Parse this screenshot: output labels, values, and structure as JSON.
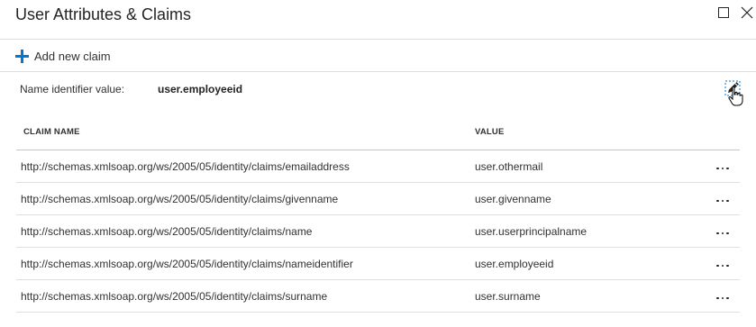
{
  "header": {
    "title": "User Attributes & Claims",
    "maximize_icon": "maximize-icon",
    "close_icon": "close-icon"
  },
  "toolbar": {
    "add_claim_label": "Add new claim",
    "add_icon": "plus-icon",
    "accent_color": "#0078d4"
  },
  "name_identifier": {
    "label": "Name identifier value:",
    "value": "user.employeeid",
    "edit_icon": "edit-icon"
  },
  "table": {
    "columns": {
      "claim_name": "CLAIM NAME",
      "value": "VALUE"
    },
    "rows": [
      {
        "claim_name": "http://schemas.xmlsoap.org/ws/2005/05/identity/claims/emailaddress",
        "value": "user.othermail"
      },
      {
        "claim_name": "http://schemas.xmlsoap.org/ws/2005/05/identity/claims/givenname",
        "value": "user.givenname"
      },
      {
        "claim_name": "http://schemas.xmlsoap.org/ws/2005/05/identity/claims/name",
        "value": "user.userprincipalname"
      },
      {
        "claim_name": "http://schemas.xmlsoap.org/ws/2005/05/identity/claims/nameidentifier",
        "value": "user.employeeid"
      },
      {
        "claim_name": "http://schemas.xmlsoap.org/ws/2005/05/identity/claims/surname",
        "value": "user.surname"
      }
    ],
    "row_action_icon": "more-options-icon"
  }
}
